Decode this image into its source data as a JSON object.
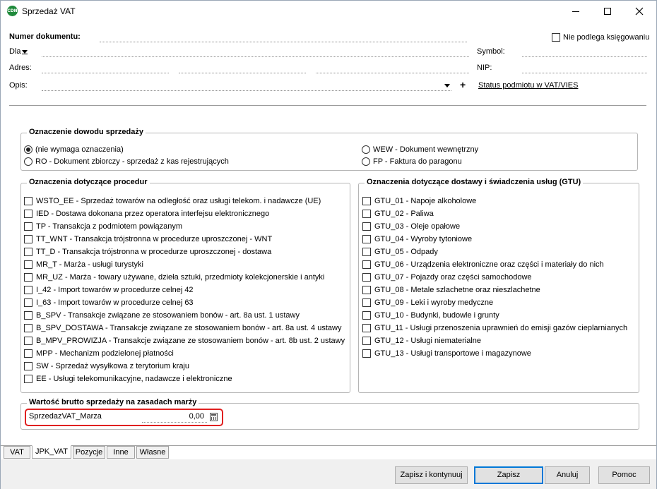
{
  "window": {
    "title": "Sprzedaż VAT",
    "app_icon_text": "CDN",
    "minimize_glyph": "—",
    "maximize_glyph": "☐",
    "close_glyph": "✕"
  },
  "header": {
    "doc_number_label": "Numer dokumentu:",
    "not_booked_label": "Nie podlega księgowaniu",
    "not_booked_checked": false,
    "for_label": "Dla",
    "symbol_label": "Symbol:",
    "address_label": "Adres:",
    "nip_label": "NIP:",
    "description_label": "Opis:",
    "plus_label": "+",
    "vat_status_link": "Status podmiotu w VAT/VIES"
  },
  "sales_evidence": {
    "title": "Oznaczenie dowodu sprzedaży",
    "options": [
      {
        "label": "(nie wymaga oznaczenia)",
        "checked": true
      },
      {
        "label": "RO - Dokument zbiorczy - sprzedaż z kas rejestrujących",
        "checked": false
      },
      {
        "label": "WEW - Dokument wewnętrzny",
        "checked": false
      },
      {
        "label": "FP - Faktura do paragonu",
        "checked": false
      }
    ]
  },
  "procedures": {
    "title": "Oznaczenia dotyczące procedur",
    "items": [
      "WSTO_EE - Sprzedaż towarów na odległość oraz usługi telekom. i nadawcze (UE)",
      "IED - Dostawa dokonana przez operatora interfejsu elektronicznego",
      "TP - Transakcja z podmiotem powiązanym",
      "TT_WNT - Transakcja trójstronna w procedurze uproszczonej - WNT",
      "TT_D - Transakcja trójstronna w procedurze uproszczonej - dostawa",
      "MR_T - Marża - usługi turystyki",
      "MR_UZ - Marża - towary używane, dzieła sztuki, przedmioty kolekcjonerskie i antyki",
      "I_42 - Import towarów w procedurze celnej 42",
      "I_63 - Import towarów w procedurze celnej 63",
      "B_SPV - Transakcje związane ze stosowaniem bonów - art. 8a ust. 1 ustawy",
      "B_SPV_DOSTAWA - Transakcje związane ze stosowaniem bonów - art. 8a ust. 4 ustawy",
      "B_MPV_PROWIZJA - Transakcje związane ze stosowaniem bonów - art. 8b ust. 2 ustawy",
      "MPP - Mechanizm podzielonej płatności",
      "SW - Sprzedaż wysyłkowa z terytorium kraju",
      "EE - Usługi telekomunikacyjne, nadawcze i elektroniczne"
    ]
  },
  "gtu": {
    "title": "Oznaczenia dotyczące dostawy i świadczenia usług (GTU)",
    "items": [
      "GTU_01 - Napoje alkoholowe",
      "GTU_02 - Paliwa",
      "GTU_03 - Oleje opałowe",
      "GTU_04 - Wyroby tytoniowe",
      "GTU_05 - Odpady",
      "GTU_06 - Urządzenia elektroniczne oraz części i materiały do nich",
      "GTU_07 - Pojazdy oraz części samochodowe",
      "GTU_08 - Metale szlachetne oraz nieszlachetne",
      "GTU_09 - Leki i wyroby medyczne",
      "GTU_10 - Budynki, budowle i grunty",
      "GTU_11 - Usługi przenoszenia uprawnień do emisji gazów cieplarnianych",
      "GTU_12 - Usługi niematerialne",
      "GTU_13 - Usługi transportowe i magazynowe"
    ]
  },
  "margin": {
    "title": "Wartość brutto sprzedaży na zasadach marży",
    "field_label": "SprzedazVAT_Marza",
    "value": "0,00",
    "highlight_color": "#e02020"
  },
  "tabs": [
    {
      "label": "VAT",
      "active": false
    },
    {
      "label": "JPK_VAT",
      "active": true
    },
    {
      "label": "Pozycje",
      "active": false
    },
    {
      "label": "Inne",
      "active": false
    },
    {
      "label": "Własne",
      "active": false
    }
  ],
  "buttons": {
    "save_continue": "Zapisz i kontynuuj",
    "save": "Zapisz",
    "cancel": "Anuluj",
    "help": "Pomoc"
  }
}
